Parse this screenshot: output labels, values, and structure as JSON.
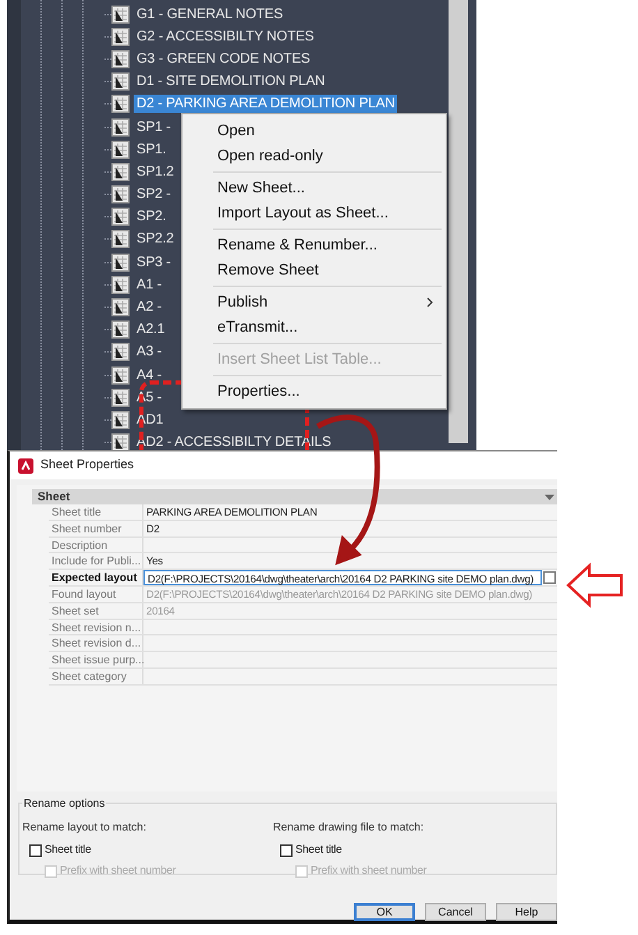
{
  "sheet_list": {
    "items": [
      {
        "label": "G1 - GENERAL NOTES",
        "selected": false
      },
      {
        "label": "G2 - ACCESSIBILTY NOTES",
        "selected": false
      },
      {
        "label": "G3 - GREEN CODE NOTES",
        "selected": false
      },
      {
        "label": "D1 - SITE DEMOLITION PLAN",
        "selected": false
      },
      {
        "label": "D2 - PARKING AREA DEMOLITION PLAN",
        "selected": true
      },
      {
        "label": "SP1 -",
        "selected": false
      },
      {
        "label": "SP1.",
        "selected": false
      },
      {
        "label": "SP1.2",
        "selected": false
      },
      {
        "label": "SP2 -",
        "selected": false
      },
      {
        "label": "SP2.",
        "selected": false
      },
      {
        "label": "SP2.2",
        "selected": false
      },
      {
        "label": "SP3 -",
        "selected": false
      },
      {
        "label": "A1 -",
        "selected": false
      },
      {
        "label": "A2 -",
        "selected": false
      },
      {
        "label": "A2.1",
        "selected": false
      },
      {
        "label": "A3 -",
        "selected": false
      },
      {
        "label": "A4 -",
        "selected": false
      },
      {
        "label": "A5 -",
        "selected": false
      },
      {
        "label": "AD1",
        "selected": false
      },
      {
        "label": "AD2 - ACCESSIBILTY DETAILS",
        "selected": false
      }
    ]
  },
  "context_menu": {
    "groups": [
      [
        {
          "label": "Open",
          "disabled": false,
          "submenu": false
        },
        {
          "label": "Open read-only",
          "disabled": false,
          "submenu": false
        }
      ],
      [
        {
          "label": "New Sheet...",
          "disabled": false,
          "submenu": false
        },
        {
          "label": "Import Layout as Sheet...",
          "disabled": false,
          "submenu": false
        }
      ],
      [
        {
          "label": "Rename & Renumber...",
          "disabled": false,
          "submenu": false
        },
        {
          "label": "Remove Sheet",
          "disabled": false,
          "submenu": false
        }
      ],
      [
        {
          "label": "Publish",
          "disabled": false,
          "submenu": true
        },
        {
          "label": "eTransmit...",
          "disabled": false,
          "submenu": false
        }
      ],
      [
        {
          "label": "Insert Sheet List Table...",
          "disabled": true,
          "submenu": false
        }
      ],
      [
        {
          "label": "Properties...",
          "disabled": false,
          "submenu": false
        }
      ]
    ]
  },
  "dialog": {
    "title": "Sheet Properties",
    "section": {
      "label": "Sheet",
      "expanded": true
    },
    "properties": [
      {
        "label": "Sheet title",
        "value": "PARKING AREA DEMOLITION PLAN",
        "readonly": false,
        "selected": false
      },
      {
        "label": "Sheet number",
        "value": "D2",
        "readonly": false,
        "selected": false
      },
      {
        "label": "Description",
        "readonly": false,
        "selected": false
      },
      {
        "label": "Include for Publi...",
        "value": "Yes",
        "readonly": false,
        "selected": false
      },
      {
        "label": "Expected layout",
        "value": "D2(F:\\PROJECTS\\20164\\dwg\\theater\\arch\\20164 D2 PARKING site DEMO plan.dwg)",
        "readonly": false,
        "selected": true
      },
      {
        "label": "Found layout",
        "value": "D2(F:\\PROJECTS\\20164\\dwg\\theater\\arch\\20164 D2 PARKING site DEMO plan.dwg)",
        "readonly": true,
        "selected": false
      },
      {
        "label": "Sheet set",
        "value": "20164",
        "readonly": true,
        "selected": false
      },
      {
        "label": "Sheet revision n...",
        "readonly": false,
        "selected": false
      },
      {
        "label": "Sheet revision d...",
        "readonly": false,
        "selected": false
      },
      {
        "label": "Sheet issue purp...",
        "readonly": false,
        "selected": false
      },
      {
        "label": "Sheet category",
        "readonly": false,
        "selected": false
      }
    ],
    "rename_options": {
      "title": "Rename options",
      "groups": [
        {
          "label": "Rename layout to match:",
          "options": [
            {
              "label": "Sheet title",
              "checked": false,
              "disabled": false,
              "children": [
                {
                  "label": "Prefix with sheet number",
                  "checked": false,
                  "disabled": true
                }
              ]
            }
          ]
        },
        {
          "label": "Rename drawing file to match:",
          "options": [
            {
              "label": "Sheet title",
              "checked": false,
              "disabled": false,
              "children": [
                {
                  "label": "Prefix with sheet number",
                  "checked": false,
                  "disabled": true
                }
              ]
            }
          ]
        }
      ]
    },
    "buttons": [
      {
        "label": "OK",
        "default": true
      },
      {
        "label": "Cancel",
        "default": false
      },
      {
        "label": "Help",
        "default": false
      }
    ]
  }
}
